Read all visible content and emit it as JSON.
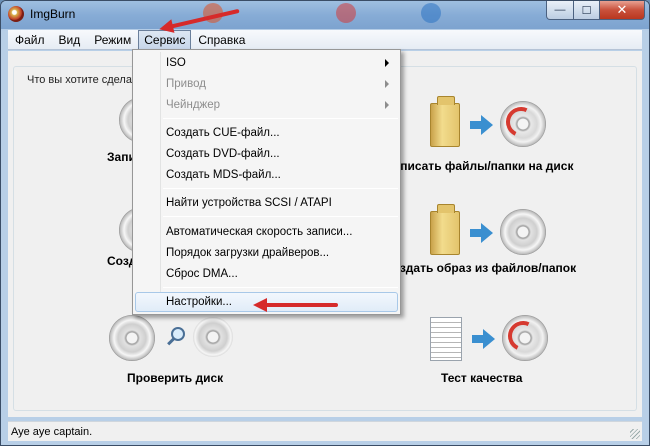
{
  "window": {
    "title": "ImgBurn",
    "controls": {
      "minimize": "—",
      "maximize": "☐",
      "close": "✕"
    }
  },
  "menubar": {
    "items": [
      "Файл",
      "Вид",
      "Режим",
      "Сервис",
      "Справка"
    ],
    "active": "Сервис"
  },
  "main": {
    "prompt": "Что вы хотите сделать?",
    "actions": [
      {
        "label": "Записать образ на диск"
      },
      {
        "label": "Записать файлы/папки на диск"
      },
      {
        "label": "Создать образ диска"
      },
      {
        "label": "Создать образ из файлов/папок"
      },
      {
        "label": "Проверить диск"
      },
      {
        "label": "Тест качества"
      }
    ]
  },
  "service_menu": {
    "items": [
      {
        "label": "ISO",
        "submenu": true,
        "disabled": false
      },
      {
        "label": "Привод",
        "submenu": true,
        "disabled": true
      },
      {
        "label": "Чейнджер",
        "submenu": true,
        "disabled": true
      },
      {
        "label": "Создать CUE-файл...",
        "submenu": false,
        "disabled": false
      },
      {
        "label": "Создать DVD-файл...",
        "submenu": false,
        "disabled": false
      },
      {
        "label": "Создать MDS-файл...",
        "submenu": false,
        "disabled": false
      },
      {
        "label": "Найти устройства SCSI / ATAPI",
        "submenu": false,
        "disabled": false
      },
      {
        "label": "Автоматическая скорость записи...",
        "submenu": false,
        "disabled": false
      },
      {
        "label": "Порядок загрузки драйверов...",
        "submenu": false,
        "disabled": false
      },
      {
        "label": "Сброс DMA...",
        "submenu": false,
        "disabled": false
      },
      {
        "label": "Настройки...",
        "submenu": false,
        "disabled": false,
        "highlighted": true
      }
    ]
  },
  "statusbar": {
    "text": "Aye aye captain."
  },
  "colors": {
    "annotation_arrow": "#d62a2a",
    "menu_highlight": "#e1ecf8"
  }
}
